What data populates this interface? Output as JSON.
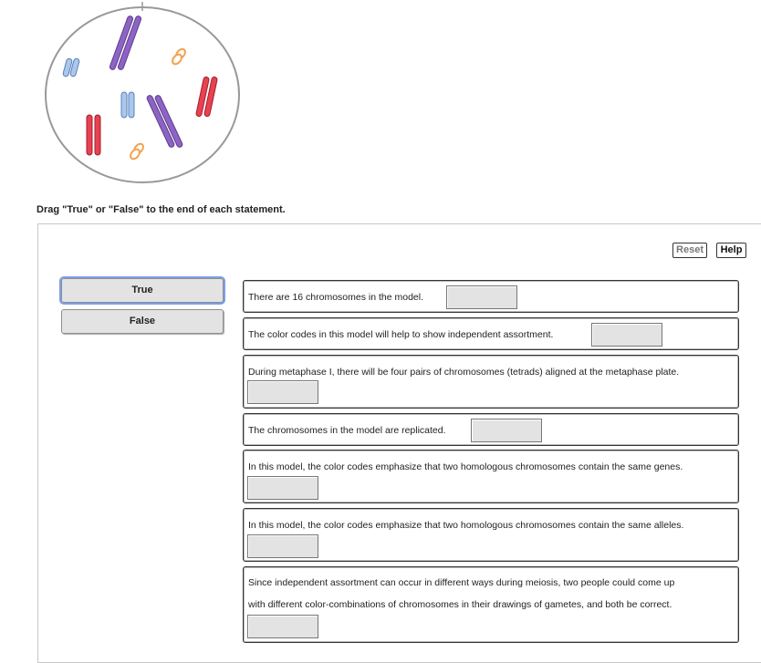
{
  "instructions": "Drag \"True\" or \"False\" to the end of each statement.",
  "toolbar": {
    "reset_label": "Reset",
    "help_label": "Help"
  },
  "tiles": [
    {
      "label": "True"
    },
    {
      "label": "False"
    }
  ],
  "statements": [
    {
      "text": "There are 16 chromosomes in the model."
    },
    {
      "text": "The color codes in this model will help to show independent assortment."
    },
    {
      "text": "During metaphase I, there will be four pairs of chromosomes (tetrads) aligned at the metaphase plate."
    },
    {
      "text": "The chromosomes in the model are replicated."
    },
    {
      "text": "In this model, the color codes emphasize that two homologous chromosomes contain the same genes."
    },
    {
      "text": "In this model, the color codes emphasize that two homologous chromosomes contain the same alleles."
    },
    {
      "line1": "Since independent assortment can occur in different ways during meiosis, two people could come up",
      "line2": "with different color-combinations of chromosomes in their drawings of gametes, and both be correct."
    }
  ],
  "colors": {
    "purple": "#8e63c6",
    "red": "#e8414f",
    "blue": "#a9c8ef",
    "orange": "#f5a04a",
    "tile_bg": "#e3e3e3",
    "focus_outline": "#7b9fe6"
  }
}
